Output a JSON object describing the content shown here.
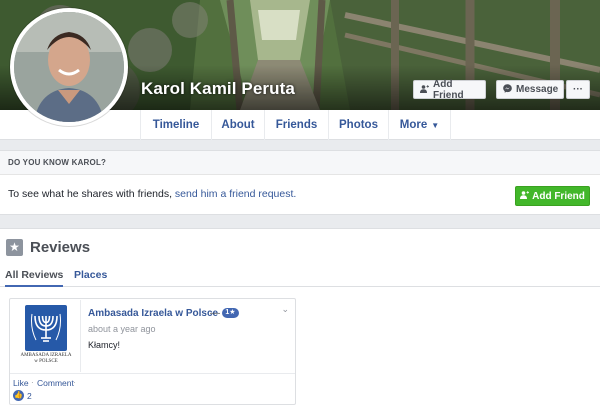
{
  "profile": {
    "name": "Karol Kamil Peruta"
  },
  "cover_actions": {
    "add_friend": "Add Friend",
    "message": "Message",
    "more": "···"
  },
  "nav": {
    "items": [
      {
        "label": "Timeline"
      },
      {
        "label": "About"
      },
      {
        "label": "Friends"
      },
      {
        "label": "Photos"
      },
      {
        "label": "More"
      }
    ]
  },
  "know_box": {
    "heading": "DO YOU KNOW KAROL?",
    "text_prefix": "To see what he shares with friends, ",
    "link_text": "send him a friend request.",
    "button_label": "Add Friend"
  },
  "reviews": {
    "title": "Reviews",
    "tabs": [
      "All Reviews",
      "Places"
    ],
    "items": [
      {
        "page_name": "Ambasada Izraela w Polsce",
        "dash": "—",
        "rating": "1★",
        "time": "about a year ago",
        "text": "Kłamcy!",
        "emblem_caption_1": "AMBASADA IZRAELA",
        "emblem_caption_2": "w POLSCE",
        "like_label": "Like",
        "separator": "·",
        "comment_label": "Comment",
        "like_count": "2"
      }
    ]
  },
  "icons": {
    "add_friend": "person-plus-icon",
    "message": "messenger-icon",
    "star": "star-icon",
    "like": "thumbs-up-icon"
  },
  "colors": {
    "link": "#365899",
    "accent": "#4267b2",
    "green": "#42b72a"
  }
}
